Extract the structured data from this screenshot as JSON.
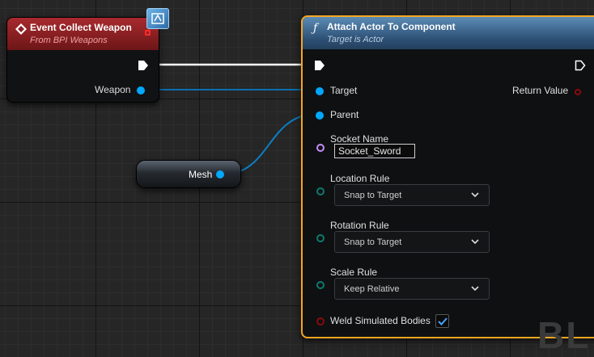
{
  "event_node": {
    "title": "Event Collect Weapon",
    "subtitle": "From BPI Weapons",
    "output_pin": "Weapon"
  },
  "mesh_node": {
    "label": "Mesh"
  },
  "attach_node": {
    "title": "Attach Actor To Component",
    "subtitle": "Target is Actor",
    "pins": {
      "target": "Target",
      "parent": "Parent",
      "return_value": "Return Value"
    },
    "socket_name": {
      "label": "Socket Name",
      "value": "Socket_Sword"
    },
    "location_rule": {
      "label": "Location Rule",
      "value": "Snap to Target"
    },
    "rotation_rule": {
      "label": "Rotation Rule",
      "value": "Snap to Target"
    },
    "scale_rule": {
      "label": "Scale Rule",
      "value": "Keep Relative"
    },
    "weld": {
      "label": "Weld Simulated Bodies",
      "checked": true
    }
  },
  "watermark": "BL",
  "colors": {
    "object_pin": "#00a8ff",
    "name_pin": "#c58cff",
    "enum_pin": "#0c7a6a",
    "bool_pin": "#8b0a0a",
    "selection": "#f5a623",
    "event_header": "#a82a2e",
    "function_header": "#4a7ba6"
  }
}
